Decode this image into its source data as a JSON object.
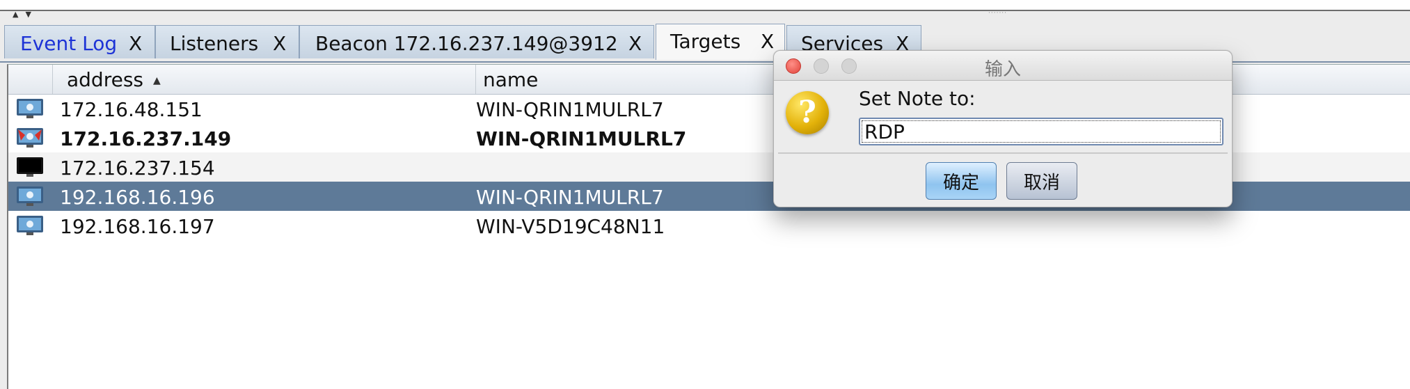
{
  "tabs": [
    {
      "label": "Event Log",
      "close": "X"
    },
    {
      "label": "Listeners",
      "close": "X"
    },
    {
      "label": "Beacon 172.16.237.149@3912",
      "close": "X"
    },
    {
      "label": "Targets",
      "close": "X"
    },
    {
      "label": "Services",
      "close": "X"
    }
  ],
  "table": {
    "columns": {
      "address": "address",
      "name": "name"
    },
    "rows": [
      {
        "address": "172.16.48.151",
        "name": "WIN-QRIN1MULRL7"
      },
      {
        "address": "172.16.237.149",
        "name": "WIN-QRIN1MULRL7"
      },
      {
        "address": "172.16.237.154",
        "name": ""
      },
      {
        "address": "192.168.16.196",
        "name": "WIN-QRIN1MULRL7"
      },
      {
        "address": "192.168.16.197",
        "name": "WIN-V5D19C48N11"
      }
    ]
  },
  "dialog": {
    "title": "输入",
    "prompt": "Set Note to:",
    "input_value": "RDP",
    "ok_label": "确定",
    "cancel_label": "取消"
  },
  "colors": {
    "selected_row": "#5e7a98",
    "active_tab_text": "#1d33d6",
    "close_button": "#e0443b"
  },
  "icons": {
    "host_windows": "monitor-windows-icon",
    "host_compromised": "monitor-compromised-icon",
    "host_unknown": "monitor-blank-icon",
    "question": "question-icon"
  }
}
